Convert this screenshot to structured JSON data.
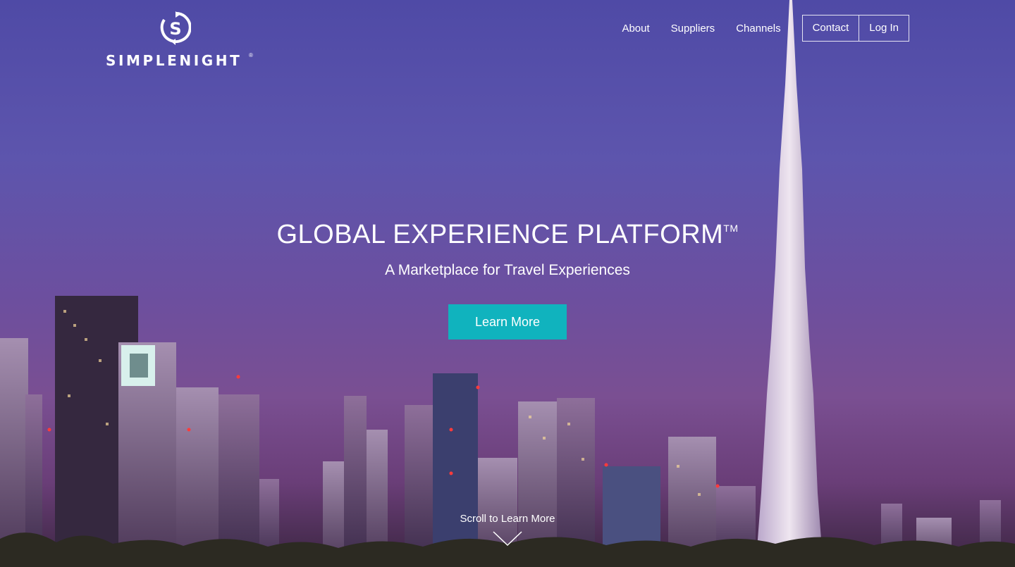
{
  "brand": {
    "name": "SIMPLENIGHT",
    "registered": "®",
    "logo_icon": "dollar-circle-icon"
  },
  "nav": {
    "links": [
      "About",
      "Suppliers",
      "Channels"
    ],
    "contact_label": "Contact",
    "login_label": "Log In"
  },
  "hero": {
    "headline": "GLOBAL EXPERIENCE PLATFORM",
    "trademark": "TM",
    "subheadline": "A Marketplace for Travel Experiences",
    "cta_label": "Learn More",
    "scroll_label": "Scroll to Learn More",
    "scroll_icon": "chevron-down-icon"
  },
  "colors": {
    "cta": "#10b3be",
    "sky_top": "#4f4aa6",
    "sky_bottom": "#6a3e78"
  }
}
